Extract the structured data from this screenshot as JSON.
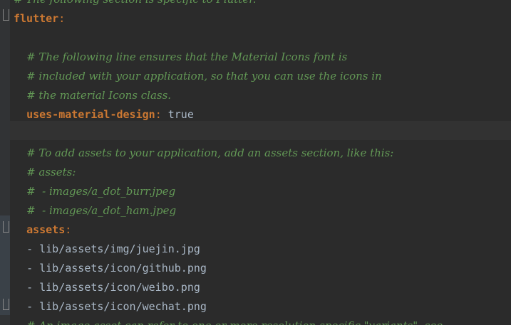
{
  "editor": {
    "lines": [
      {
        "type": "comment",
        "indent": "",
        "text": "# The following section is specific to Flutter."
      },
      {
        "type": "key",
        "indent": "",
        "key": "flutter",
        "sep": ":",
        "value": ""
      },
      {
        "type": "blank"
      },
      {
        "type": "comment",
        "indent": "  ",
        "text": "# The following line ensures that the Material Icons font is"
      },
      {
        "type": "comment",
        "indent": "  ",
        "text": "# included with your application, so that you can use the icons in"
      },
      {
        "type": "comment",
        "indent": "  ",
        "text": "# the material Icons class."
      },
      {
        "type": "key",
        "indent": "  ",
        "key": "uses-material-design",
        "sep": ":",
        "value": " true"
      },
      {
        "type": "blank",
        "current": true
      },
      {
        "type": "comment",
        "indent": "  ",
        "text": "# To add assets to your application, add an assets section, like this:"
      },
      {
        "type": "comment",
        "indent": "  ",
        "text": "# assets:"
      },
      {
        "type": "comment",
        "indent": "  ",
        "text": "#  - images/a_dot_burr.jpeg"
      },
      {
        "type": "comment",
        "indent": "  ",
        "text": "#  - images/a_dot_ham.jpeg"
      },
      {
        "type": "key",
        "indent": "  ",
        "key": "assets",
        "sep": ":",
        "value": ""
      },
      {
        "type": "plain",
        "indent": "  ",
        "text": "- lib/assets/img/juejin.jpg"
      },
      {
        "type": "plain",
        "indent": "  ",
        "text": "- lib/assets/icon/github.png"
      },
      {
        "type": "plain",
        "indent": "  ",
        "text": "- lib/assets/icon/weibo.png"
      },
      {
        "type": "plain",
        "indent": "  ",
        "text": "- lib/assets/icon/wechat.png"
      },
      {
        "type": "comment",
        "indent": "  ",
        "text": "# An image asset can refer to one or more resolution-specific \"variants\", see"
      }
    ]
  },
  "colors": {
    "background": "#2b2b2b",
    "comment": "#629755",
    "key": "#cc7832",
    "text": "#a9b7c6",
    "gutter": "#313335"
  },
  "icons": [
    "fold-marker-icon"
  ]
}
